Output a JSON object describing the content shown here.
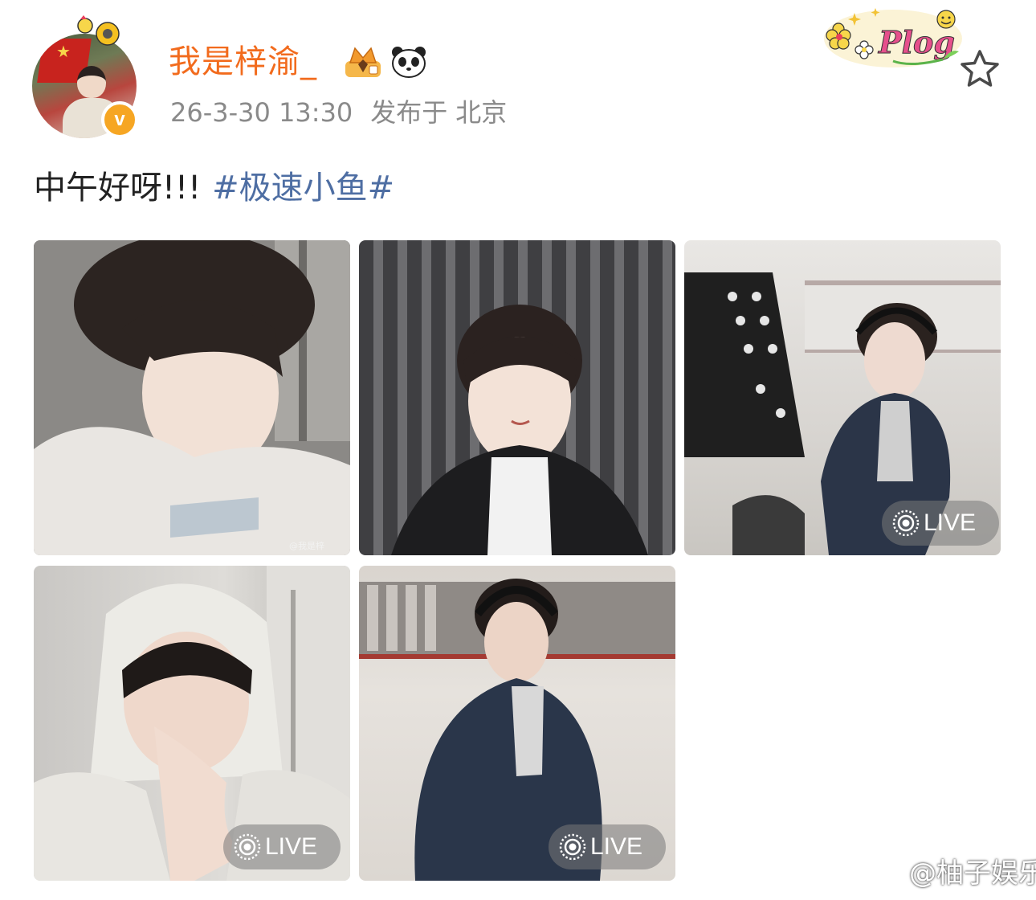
{
  "post": {
    "author": {
      "name": "我是梓渝_",
      "verified_badge": "v"
    },
    "meta": {
      "timestamp": "26-3-30 13:30",
      "location_prefix": "发布于",
      "location": "北京"
    },
    "text": "中午好呀!!!",
    "hashtag": "#极速小鱼#",
    "sticker": "Plog",
    "photos": [
      {
        "live": false,
        "watermark": "@我是梓"
      },
      {
        "live": false
      },
      {
        "live": true,
        "badge": "LIVE"
      },
      {
        "live": true,
        "badge": "LIVE"
      },
      {
        "live": true,
        "badge": "LIVE"
      }
    ]
  },
  "source_watermark": "@柚子娱乐",
  "colors": {
    "username": "#f26b1d",
    "hashtag": "#4e6ea3",
    "meta": "#8a8a8a",
    "verified": "#f6a623"
  },
  "icons": {
    "favorite": "star-outline-icon",
    "crown": "crown-icon",
    "panda": "panda-icon",
    "live": "live-circle-icon",
    "weibo": "weibo-logo-icon"
  }
}
